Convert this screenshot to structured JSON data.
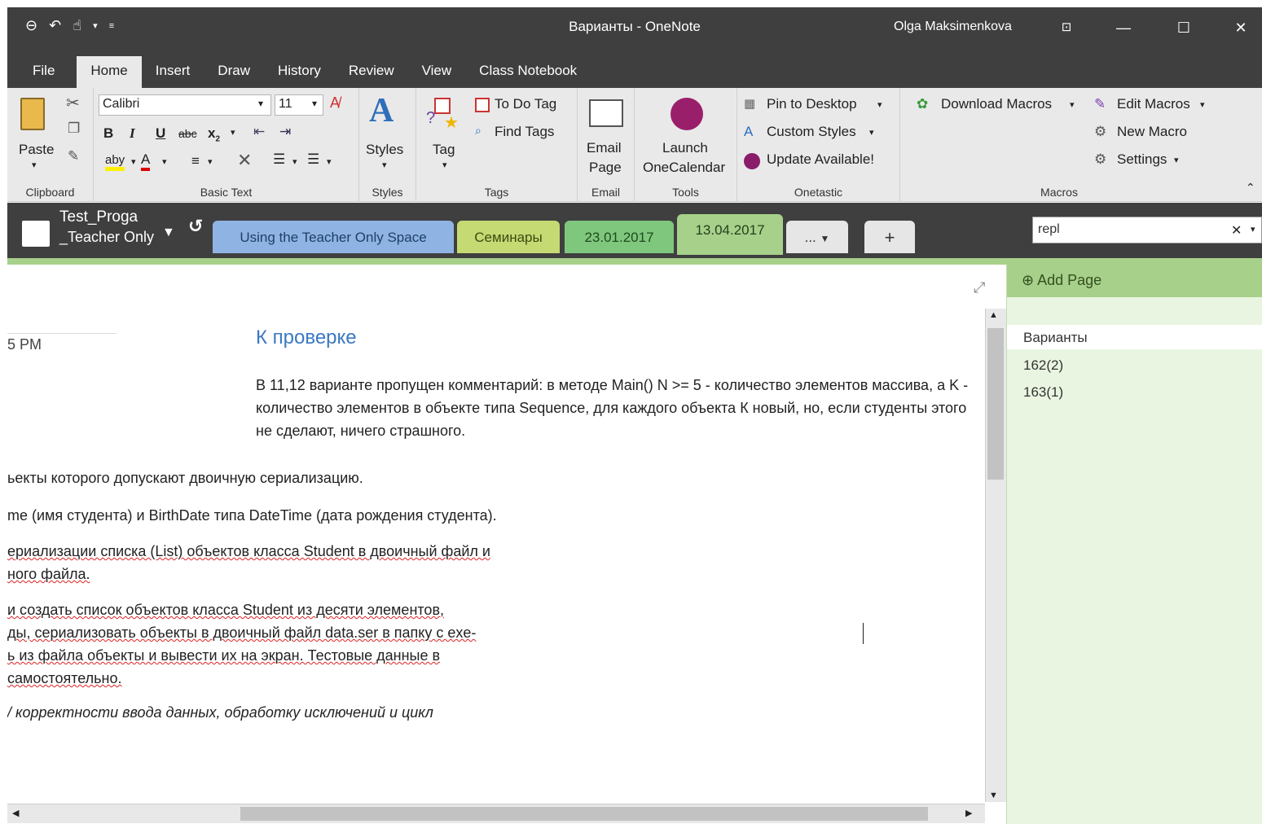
{
  "window": {
    "title": "Варианты  -  OneNote",
    "user": "Olga Maksimenkova"
  },
  "menu_tabs": [
    "File",
    "Home",
    "Insert",
    "Draw",
    "History",
    "Review",
    "View",
    "Class Notebook"
  ],
  "ribbon": {
    "clipboard": {
      "paste": "Paste",
      "label": "Clipboard"
    },
    "basic_text": {
      "font": "Calibri",
      "size": "11",
      "label": "Basic Text"
    },
    "styles": {
      "button": "Styles",
      "label": "Styles"
    },
    "tags": {
      "tag": "Tag",
      "todo": "To Do Tag",
      "find": "Find Tags",
      "label": "Tags"
    },
    "email": {
      "line1": "Email",
      "line2": "Page",
      "label": "Email"
    },
    "tools": {
      "line1": "Launch",
      "line2": "OneCalendar",
      "label": "Tools"
    },
    "onetastic": {
      "pin": "Pin to Desktop",
      "custom": "Custom Styles",
      "update": "Update Available!",
      "label": "Onetastic"
    },
    "macros": {
      "download": "Download Macros",
      "edit": "Edit Macros",
      "new": "New Macro",
      "settings": "Settings",
      "label": "Macros"
    }
  },
  "notebook": {
    "name_line1": "Test_Proga",
    "name_line2": "_Teacher Only"
  },
  "sections": [
    {
      "label": "Using the Teacher Only Space",
      "color": "#8fb4e3"
    },
    {
      "label": "Семинары",
      "color": "#c5da72"
    },
    {
      "label": "23.01.2017",
      "color": "#7fc77d"
    },
    {
      "label": "13.04.2017",
      "color": "#a7d08a"
    }
  ],
  "section_more": "...",
  "search": {
    "value": "repl"
  },
  "page": {
    "time_fragment": "5 PM",
    "title": "К проверке",
    "note": "В 11,12 варианте пропущен комментарий: в методе Main() N >= 5 - количество элементов массива, а K - количество элементов в объекте типа Sequence, для каждого объекта К новый, но, если студенты этого не сделают, ничего страшного.",
    "lines": [
      "ьекты которого допускают двоичную сериализацию.",
      "me (имя студента) и BirthDate типа DateTime (дата рождения студента).",
      "ериализации списка (List) объектов класса Student в двоичный файл и",
      "ного файла.",
      "и создать список объектов класса Student из десяти элементов,",
      "ды, сериализовать объекты в двоичный файл data.ser в папку с exe-",
      "ь из файла объекты и вывести их на экран. Тестовые данные в",
      " самостоятельно.",
      "/ корректности ввода данных, обработку исключений и цикл"
    ]
  },
  "pages_panel": {
    "add_page": "Add Page",
    "items": [
      "Варианты",
      "162(2)",
      "163(1)"
    ]
  }
}
